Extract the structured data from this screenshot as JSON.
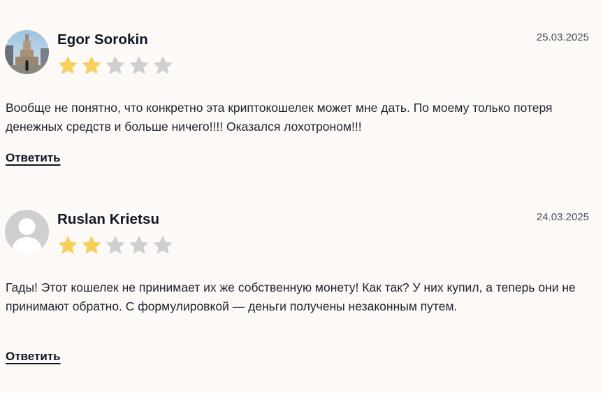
{
  "reviews": [
    {
      "author": "Egor Sorokin",
      "date": "25.03.2025",
      "rating": 2,
      "max_rating": 5,
      "avatar": "photo-avatar",
      "text": "Вообще не понятно, что конкретно эта криптокошелек может мне дать. По моему только потеря денежных средств и больше ничего!!!! Оказался лохотроном!!!",
      "reply_label": "Ответить"
    },
    {
      "author": "Ruslan Krietsu",
      "date": "24.03.2025",
      "rating": 2,
      "max_rating": 5,
      "avatar": "default-user-avatar",
      "text": "Гады! Этот кошелек не принимает их же собственную монету! Как так? У них купил, а теперь они не принимают обратно. С формулировкой — деньги получены незаконным путем.",
      "reply_label": "Ответить"
    }
  ],
  "colors": {
    "background": "#fdf9f6",
    "star_filled": "#f7cf5c",
    "star_empty": "#cfcfd2",
    "text": "#1e2330"
  }
}
